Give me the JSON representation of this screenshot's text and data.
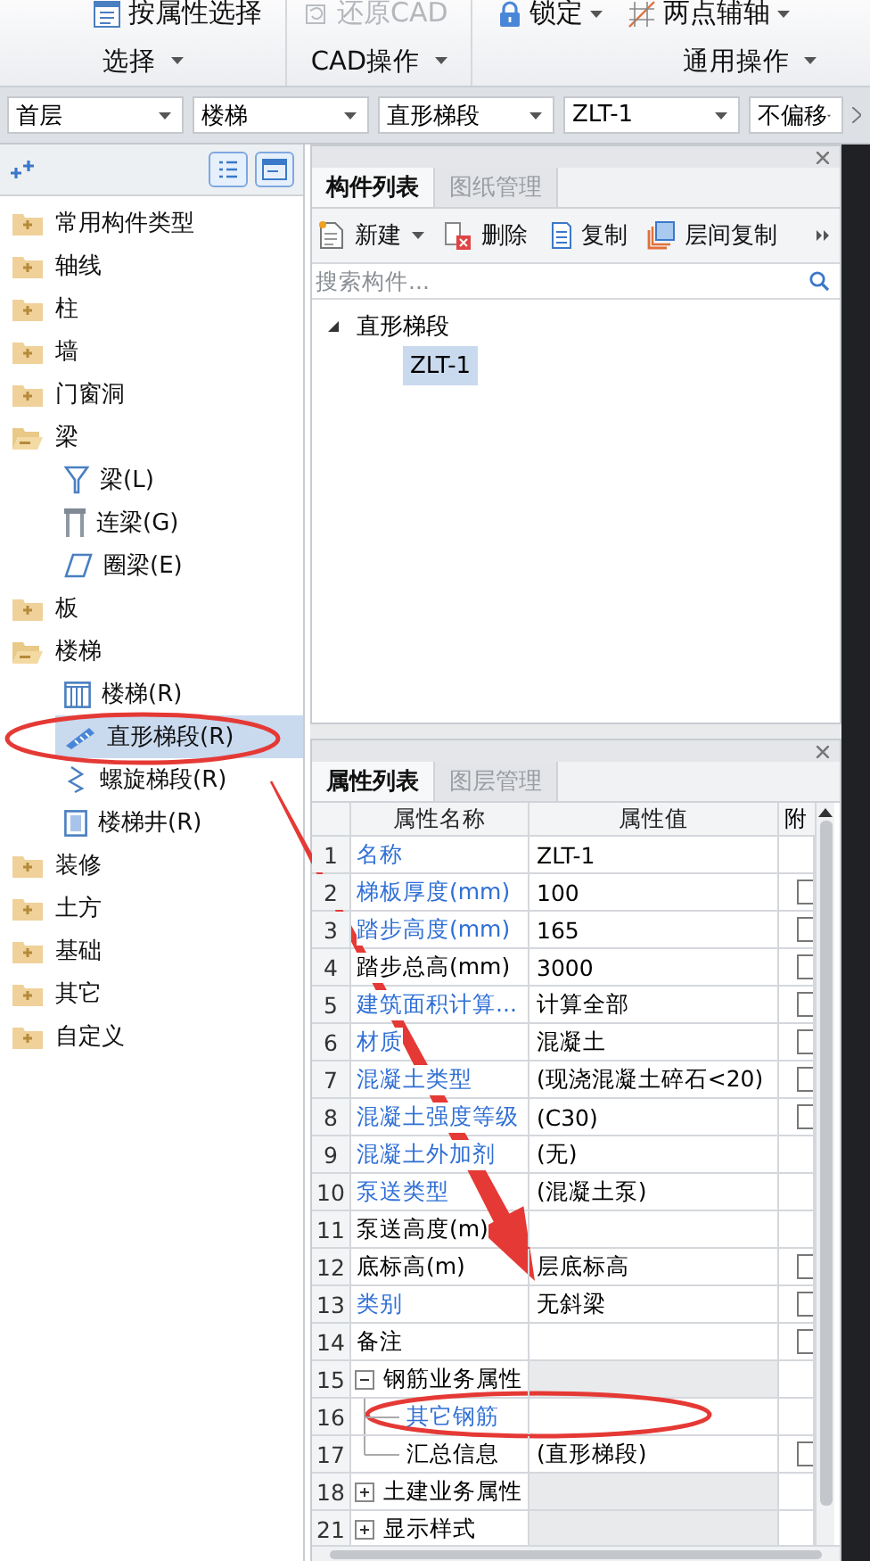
{
  "ribbon": {
    "groups": [
      {
        "label": "选择",
        "buttons": [
          {
            "label": "按属性选择",
            "disabled": false,
            "dropdown": false
          }
        ]
      },
      {
        "label": "CAD操作",
        "buttons": [
          {
            "label": "还原CAD",
            "disabled": true,
            "dropdown": false
          }
        ]
      },
      {
        "label": "通用操作",
        "buttons": [
          {
            "label": "锁定",
            "disabled": false,
            "dropdown": true
          },
          {
            "label": "两点辅轴",
            "disabled": false,
            "dropdown": true
          }
        ]
      }
    ]
  },
  "selectors": [
    "首层",
    "楼梯",
    "直形梯段",
    "ZLT-1",
    "不偏移"
  ],
  "nav_tree": {
    "items": [
      {
        "label": "常用构件类型",
        "expanded": false
      },
      {
        "label": "轴线",
        "expanded": false
      },
      {
        "label": "柱",
        "expanded": false
      },
      {
        "label": "墙",
        "expanded": false
      },
      {
        "label": "门窗洞",
        "expanded": false
      },
      {
        "label": "梁",
        "expanded": true,
        "children": [
          {
            "label": "梁(L)",
            "selected": false
          },
          {
            "label": "连梁(G)",
            "selected": false
          },
          {
            "label": "圈梁(E)",
            "selected": false
          }
        ]
      },
      {
        "label": "板",
        "expanded": false
      },
      {
        "label": "楼梯",
        "expanded": true,
        "children": [
          {
            "label": "楼梯(R)",
            "selected": false
          },
          {
            "label": "直形梯段(R)",
            "selected": true
          },
          {
            "label": "螺旋梯段(R)",
            "selected": false
          },
          {
            "label": "楼梯井(R)",
            "selected": false
          }
        ]
      },
      {
        "label": "装修",
        "expanded": false
      },
      {
        "label": "土方",
        "expanded": false
      },
      {
        "label": "基础",
        "expanded": false
      },
      {
        "label": "其它",
        "expanded": false
      },
      {
        "label": "自定义",
        "expanded": false
      }
    ]
  },
  "component_panel": {
    "tabs": [
      {
        "label": "构件列表",
        "selected": true
      },
      {
        "label": "图纸管理",
        "selected": false
      }
    ],
    "toolbar": [
      {
        "label": "新建",
        "dropdown": true
      },
      {
        "label": "删除",
        "dropdown": false
      },
      {
        "label": "复制",
        "dropdown": false
      },
      {
        "label": "层间复制",
        "dropdown": false
      }
    ],
    "search": {
      "placeholder": "搜索构件..."
    },
    "tree": [
      {
        "label": "直形梯段",
        "expanded": true,
        "children": [
          {
            "label": "ZLT-1",
            "selected": true
          }
        ]
      }
    ]
  },
  "property_panel": {
    "tabs": [
      {
        "label": "属性列表",
        "selected": true
      },
      {
        "label": "图层管理",
        "selected": false
      }
    ],
    "columns": [
      "属性名称",
      "属性值",
      "附"
    ],
    "rows": [
      {
        "kind": "field",
        "index": "1",
        "name": "名称",
        "value": "ZLT-1",
        "linked": true
      },
      {
        "kind": "field",
        "index": "2",
        "name": "梯板厚度(mm)",
        "value": "100",
        "linked": true,
        "attached": false
      },
      {
        "kind": "field",
        "index": "3",
        "name": "踏步高度(mm)",
        "value": "165",
        "linked": true,
        "attached": false
      },
      {
        "kind": "field",
        "index": "4",
        "name": "踏步总高(mm)",
        "value": "3000",
        "linked": false,
        "attached": false
      },
      {
        "kind": "field",
        "index": "5",
        "name": "建筑面积计算...",
        "value": "计算全部",
        "linked": true,
        "attached": false
      },
      {
        "kind": "field",
        "index": "6",
        "name": "材质",
        "value": "混凝土",
        "linked": true,
        "attached": false
      },
      {
        "kind": "field",
        "index": "7",
        "name": "混凝土类型",
        "value": "(现浇混凝土碎石<20)",
        "linked": true,
        "attached": false
      },
      {
        "kind": "field",
        "index": "8",
        "name": "混凝土强度等级",
        "value": "(C30)",
        "linked": true,
        "attached": false
      },
      {
        "kind": "field",
        "index": "9",
        "name": "混凝土外加剂",
        "value": "(无)",
        "linked": true
      },
      {
        "kind": "field",
        "index": "10",
        "name": "泵送类型",
        "value": "(混凝土泵)",
        "linked": true
      },
      {
        "kind": "field",
        "index": "11",
        "name": "泵送高度(m)",
        "linked": false
      },
      {
        "kind": "field",
        "index": "12",
        "name": "底标高(m)",
        "value": "层底标高",
        "linked": false,
        "attached": false
      },
      {
        "kind": "field",
        "index": "13",
        "name": "类别",
        "value": "无斜梁",
        "linked": true,
        "attached": false
      },
      {
        "kind": "field",
        "index": "14",
        "name": "备注",
        "linked": false,
        "attached": false
      },
      {
        "kind": "group",
        "index": "15",
        "name": "钢筋业务属性",
        "expanded": true
      },
      {
        "kind": "child",
        "index": "16",
        "name": "其它钢筋",
        "linked": true
      },
      {
        "kind": "child",
        "index": "17",
        "name": "汇总信息",
        "value": "(直形梯段)",
        "linked": false,
        "attached": false
      },
      {
        "kind": "group",
        "index": "18",
        "name": "土建业务属性",
        "expanded": false
      },
      {
        "kind": "group",
        "index": "21",
        "name": "显示样式",
        "expanded": false
      }
    ]
  },
  "annotations": [
    {
      "kind": "ellipse"
    },
    {
      "kind": "arrow"
    },
    {
      "kind": "ellipse"
    }
  ]
}
